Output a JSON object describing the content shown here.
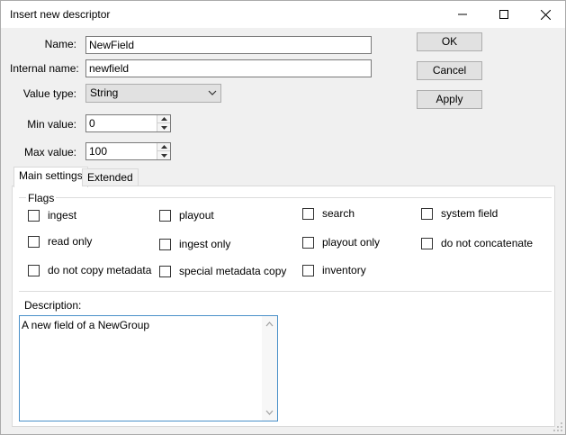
{
  "window": {
    "title": "Insert new descriptor"
  },
  "form": {
    "name_label": "Name:",
    "name_value": "NewField",
    "internal_name_label": "Internal name:",
    "internal_name_value": "newfield",
    "value_type_label": "Value type:",
    "value_type_value": "String",
    "min_value_label": "Min value:",
    "min_value": "0",
    "max_value_label": "Max value:",
    "max_value": "100"
  },
  "buttons": {
    "ok": "OK",
    "cancel": "Cancel",
    "apply": "Apply"
  },
  "tabs": [
    {
      "label": "Main settings",
      "active": true
    },
    {
      "label": "Extended",
      "active": false
    }
  ],
  "flags": {
    "group_label": "Flags",
    "items": [
      {
        "label": "ingest",
        "checked": false
      },
      {
        "label": "playout",
        "checked": false
      },
      {
        "label": "search",
        "checked": false
      },
      {
        "label": "system field",
        "checked": false
      },
      {
        "label": "read only",
        "checked": false
      },
      {
        "label": "ingest only",
        "checked": false
      },
      {
        "label": "playout only",
        "checked": false
      },
      {
        "label": "do not concatenate",
        "checked": false
      },
      {
        "label": "do not copy metadata",
        "checked": false
      },
      {
        "label": "special metadata copy",
        "checked": false
      },
      {
        "label": "inventory",
        "checked": false
      }
    ]
  },
  "description": {
    "label": "Description:",
    "value": "A new field of a NewGroup"
  }
}
